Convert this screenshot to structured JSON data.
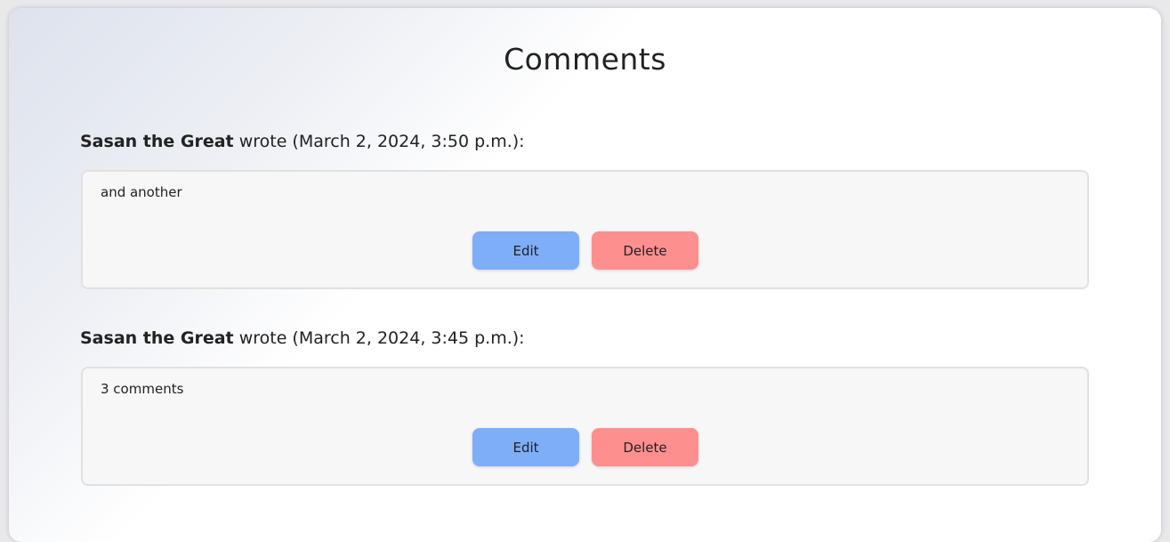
{
  "page": {
    "title": "Comments"
  },
  "comments": [
    {
      "author": "Sasan the Great",
      "meta": " wrote (March 2, 2024, 3:50 p.m.):",
      "text": "and another",
      "edit_label": "Edit",
      "delete_label": "Delete"
    },
    {
      "author": "Sasan the Great",
      "meta": " wrote (March 2, 2024, 3:45 p.m.):",
      "text": "3 comments",
      "edit_label": "Edit",
      "delete_label": "Delete"
    }
  ],
  "colors": {
    "edit_button": "#7eaef8",
    "delete_button": "#fe8f8f",
    "comment_box_bg": "#f7f7f7"
  }
}
